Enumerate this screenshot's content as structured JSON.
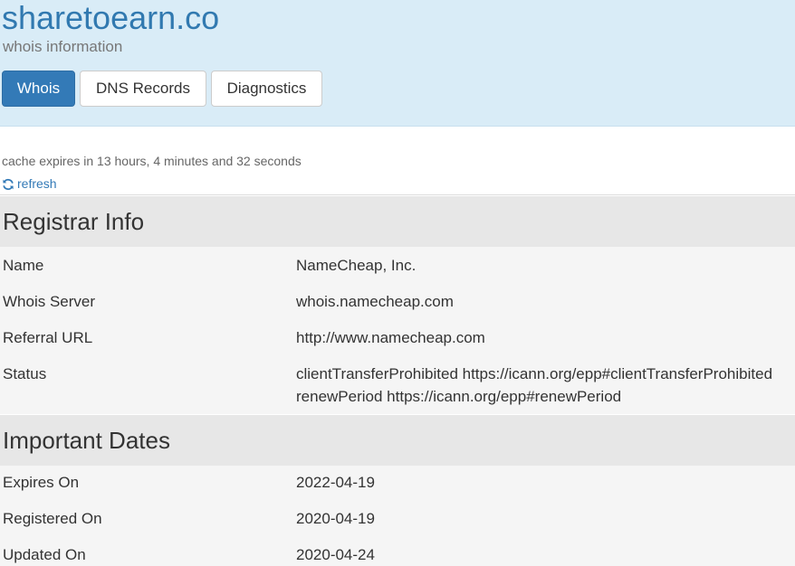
{
  "header": {
    "title": "sharetoearn.co",
    "subtitle": "whois information"
  },
  "tabs": [
    {
      "label": "Whois",
      "active": true
    },
    {
      "label": "DNS Records",
      "active": false
    },
    {
      "label": "Diagnostics",
      "active": false
    }
  ],
  "cache": {
    "text": "cache expires in 13 hours, 4 minutes and 32 seconds",
    "refresh_label": "refresh",
    "refresh_icon": "refresh-icon"
  },
  "registrar_info": {
    "heading": "Registrar Info",
    "rows": [
      {
        "key": "Name",
        "value": "NameCheap, Inc."
      },
      {
        "key": "Whois Server",
        "value": "whois.namecheap.com"
      },
      {
        "key": "Referral URL",
        "value": "http://www.namecheap.com"
      },
      {
        "key": "Status",
        "value_lines": [
          "clientTransferProhibited https://icann.org/epp#clientTransferProhibited",
          "renewPeriod https://icann.org/epp#renewPeriod"
        ]
      }
    ]
  },
  "important_dates": {
    "heading": "Important Dates",
    "rows": [
      {
        "key": "Expires On",
        "value": "2022-04-19"
      },
      {
        "key": "Registered On",
        "value": "2020-04-19"
      },
      {
        "key": "Updated On",
        "value": "2020-04-24"
      }
    ]
  },
  "colors": {
    "header_bg": "#d9ecf7",
    "title": "#3179b0",
    "accent": "#337ab7",
    "section_head_bg": "#e7e7e7",
    "row_bg": "#f5f5f5"
  }
}
